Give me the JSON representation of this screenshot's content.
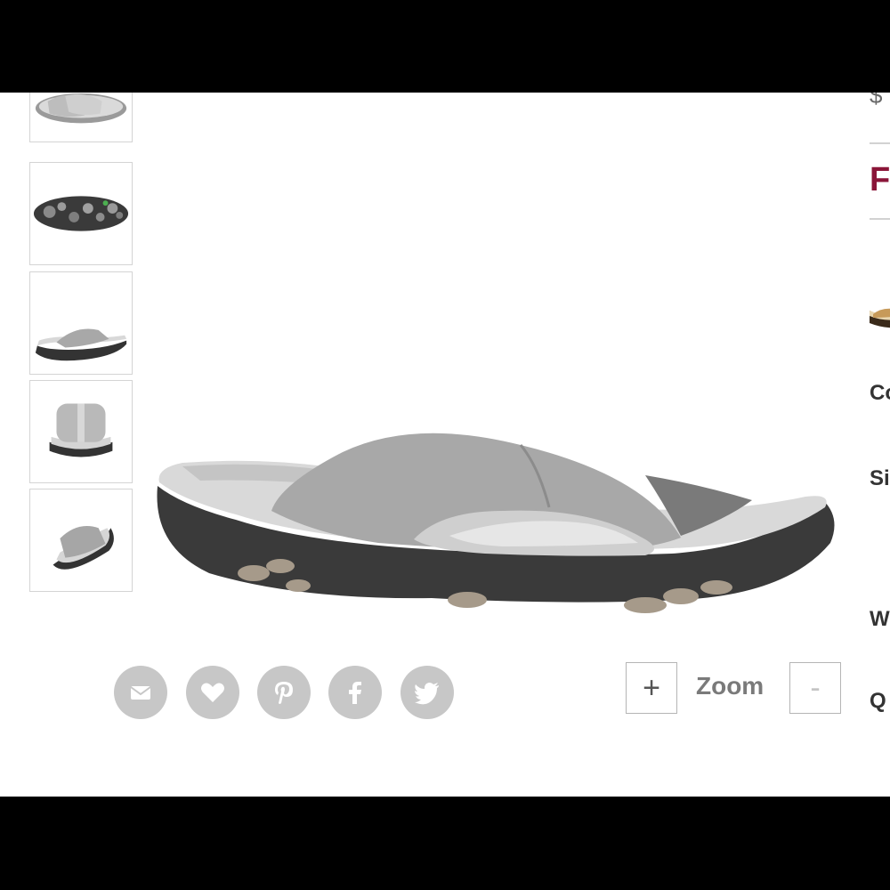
{
  "thumbnails": [
    {
      "name": "thumbnail-top-view"
    },
    {
      "name": "thumbnail-sole-view"
    },
    {
      "name": "thumbnail-side-view"
    },
    {
      "name": "thumbnail-front-view"
    },
    {
      "name": "thumbnail-angle-view"
    }
  ],
  "share": {
    "icons": [
      "email-icon",
      "heart-icon",
      "pinterest-icon",
      "facebook-icon",
      "twitter-icon"
    ]
  },
  "zoom": {
    "plus_label": "+",
    "label": "Zoom",
    "minus_label": "-"
  },
  "right_column": {
    "price_fragment": "$",
    "fit_fragment": "F",
    "color_fragment": "Co",
    "size_fragment": "Si",
    "width_fragment": "W",
    "qty_fragment": "Q"
  },
  "colors": {
    "accent": "#8a1538",
    "share_icon_bg": "#c7c7c7",
    "thumb_border": "#d4d4d4"
  }
}
